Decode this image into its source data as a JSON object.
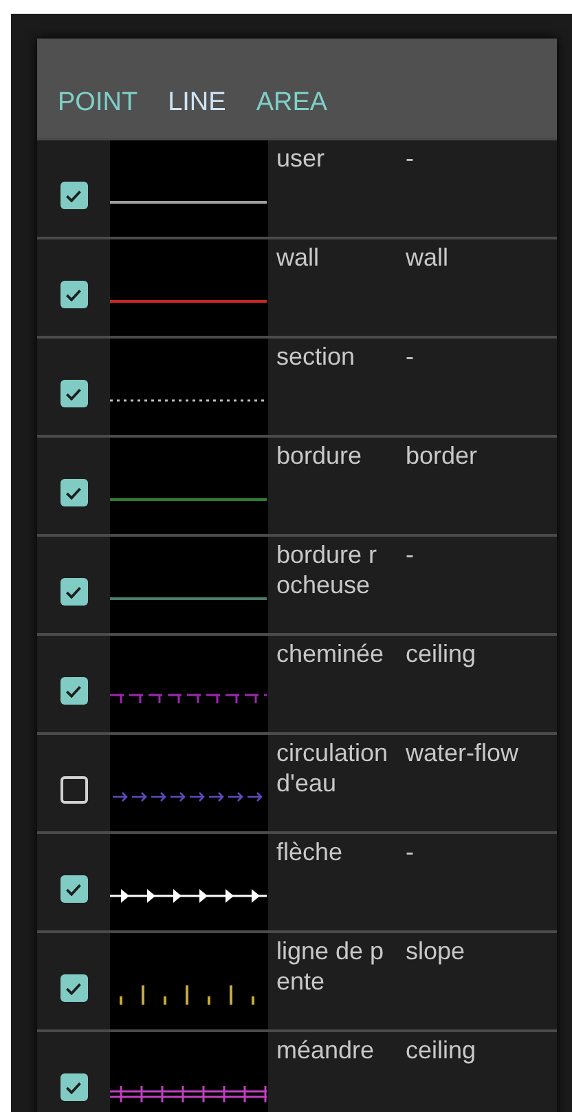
{
  "tabs": [
    {
      "label": "POINT",
      "selected": false
    },
    {
      "label": "LINE",
      "selected": true
    },
    {
      "label": "AREA",
      "selected": false
    }
  ],
  "rows": [
    {
      "checked": true,
      "kind": "solid",
      "color": "#9e9e9e",
      "name": "user",
      "type": "-"
    },
    {
      "checked": true,
      "kind": "solid",
      "color": "#c62828",
      "name": "wall",
      "type": "wall"
    },
    {
      "checked": true,
      "kind": "dotted",
      "color": "#bdbdbd",
      "name": "section",
      "type": "-"
    },
    {
      "checked": true,
      "kind": "solid",
      "color": "#2e7d32",
      "name": "bordure",
      "type": "border"
    },
    {
      "checked": true,
      "kind": "solid",
      "color": "#4a7c68",
      "name": "bordure rocheuse",
      "type": "-"
    },
    {
      "checked": true,
      "kind": "tee",
      "color": "#9c27b0",
      "name": "cheminée",
      "type": "ceiling"
    },
    {
      "checked": false,
      "kind": "arrow",
      "color": "#5c4bc0",
      "name": "circulation d'eau",
      "type": "water-flow"
    },
    {
      "checked": true,
      "kind": "arrowhead",
      "color": "#ffffff",
      "name": "flèche",
      "type": "-"
    },
    {
      "checked": true,
      "kind": "slope",
      "color": "#c8a840",
      "name": "ligne de pente",
      "type": "slope"
    },
    {
      "checked": true,
      "kind": "meander",
      "color": "#c040c0",
      "name": "méandre",
      "type": "ceiling"
    }
  ]
}
